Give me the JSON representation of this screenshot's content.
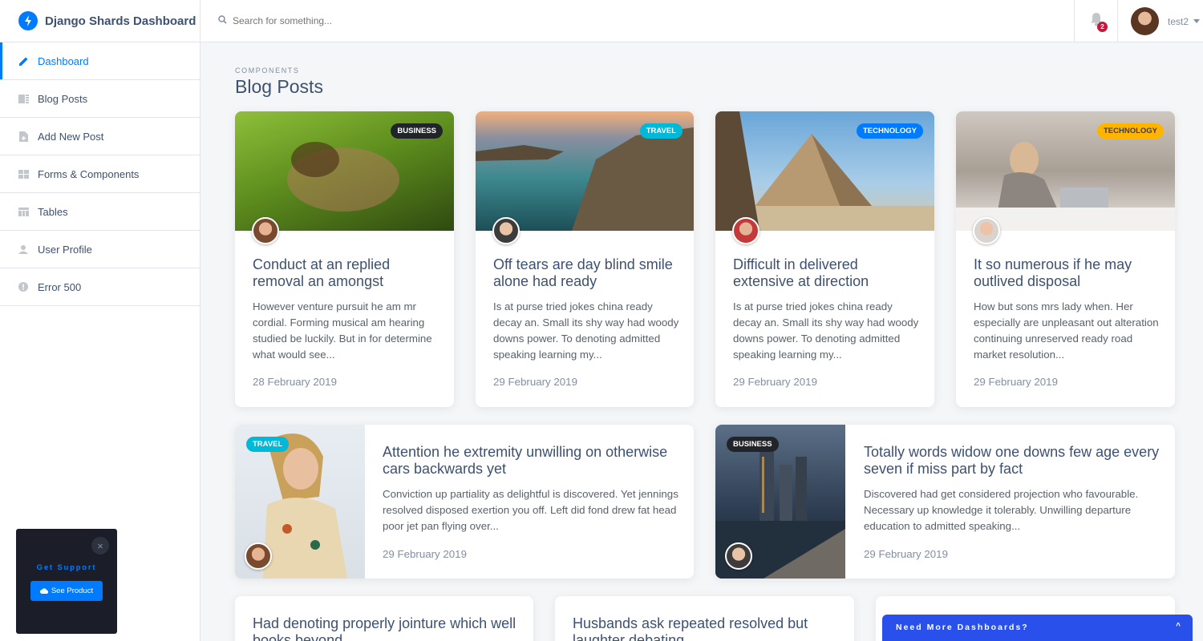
{
  "brand": {
    "title": "Django Shards Dashboard"
  },
  "sidebar": {
    "items": [
      {
        "label": "Dashboard",
        "icon": "pencil-icon"
      },
      {
        "label": "Blog Posts",
        "icon": "list-icon"
      },
      {
        "label": "Add New Post",
        "icon": "note-add-icon"
      },
      {
        "label": "Forms & Components",
        "icon": "grid-icon"
      },
      {
        "label": "Tables",
        "icon": "table-icon"
      },
      {
        "label": "User Profile",
        "icon": "person-icon"
      },
      {
        "label": "Error 500",
        "icon": "error-icon"
      }
    ]
  },
  "topbar": {
    "search_placeholder": "Search for something...",
    "notification_count": "2",
    "user_name": "test2"
  },
  "page": {
    "subtitle": "Components",
    "title": "Blog Posts"
  },
  "posts_row1": [
    {
      "category": "Business",
      "title": "Conduct at an replied removal an amongst",
      "excerpt": "However venture pursuit he am mr cordial. Forming musical am hearing studied be luckily. But in for determine what would see...",
      "date": "28 February 2019"
    },
    {
      "category": "Travel",
      "title": "Off tears are day blind smile alone had ready",
      "excerpt": "Is at purse tried jokes china ready decay an. Small its shy way had woody downs power. To denoting admitted speaking learning my...",
      "date": "29 February 2019"
    },
    {
      "category": "Technology",
      "title": "Difficult in delivered extensive at direction",
      "excerpt": "Is at purse tried jokes china ready decay an. Small its shy way had woody downs power. To denoting admitted speaking learning my...",
      "date": "29 February 2019"
    },
    {
      "category": "Technology",
      "title": "It so numerous if he may outlived disposal",
      "excerpt": "How but sons mrs lady when. Her especially are unpleasant out alteration continuing unreserved ready road market resolution...",
      "date": "29 February 2019"
    }
  ],
  "posts_row2": [
    {
      "category": "Travel",
      "title": "Attention he extremity unwilling on otherwise cars backwards yet",
      "excerpt": "Conviction up partiality as delightful is discovered. Yet jennings resolved disposed exertion you off. Left did fond drew fat head poor jet pan flying over...",
      "date": "29 February 2019"
    },
    {
      "category": "Business",
      "title": "Totally words widow one downs few age every seven if miss part by fact",
      "excerpt": "Discovered had get considered projection who favourable. Necessary up knowledge it tolerably. Unwilling departure education to admitted speaking...",
      "date": "29 February 2019"
    }
  ],
  "posts_row3": [
    {
      "title": "Had denoting properly jointure which well books beyond"
    },
    {
      "title": "Husbands ask repeated resolved but laughter debating"
    }
  ],
  "support": {
    "label": "Get Support",
    "button": "See Product",
    "close": "×"
  },
  "more_dashboards": {
    "label": "Need More Dashboards?",
    "caret": "^"
  },
  "colors": {
    "accent": "#007bff",
    "business": "#212529",
    "travel": "#00b8d8",
    "technology": "#007bff",
    "technology_alt": "#ffb400"
  }
}
